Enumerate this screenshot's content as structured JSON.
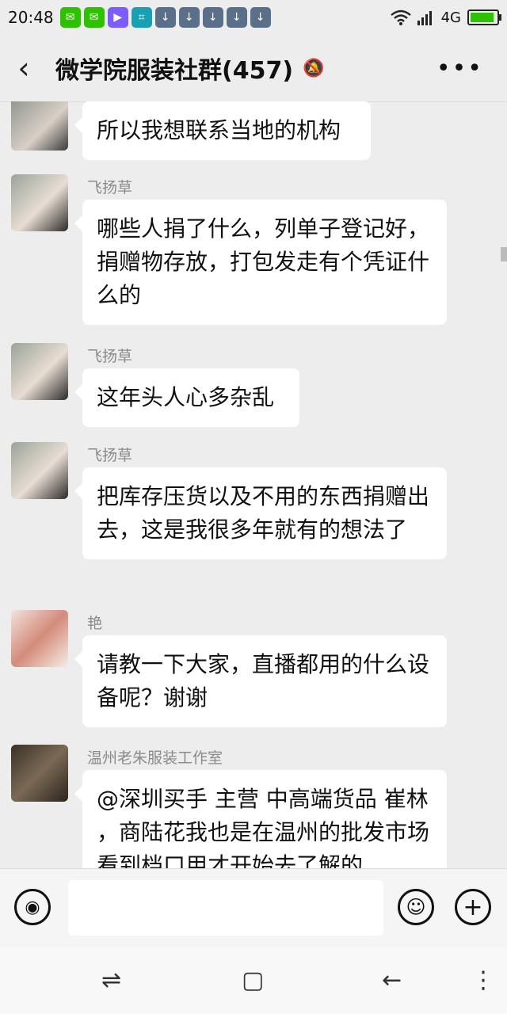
{
  "status": {
    "time": "20:48",
    "notifications": [
      {
        "icon": "wechat-icon",
        "glyph": "✉"
      },
      {
        "icon": "wechat-icon",
        "glyph": "✉"
      },
      {
        "icon": "video-icon",
        "glyph": "▶"
      },
      {
        "icon": "scan-icon",
        "glyph": "⌗"
      },
      {
        "icon": "download-icon",
        "glyph": "↓"
      },
      {
        "icon": "download-icon",
        "glyph": "↓"
      },
      {
        "icon": "download-icon",
        "glyph": "↓"
      },
      {
        "icon": "download-icon",
        "glyph": "↓"
      },
      {
        "icon": "download-icon",
        "glyph": "↓"
      }
    ],
    "network": "4G"
  },
  "header": {
    "back_glyph": "‹",
    "title": "微学院服装社群(457)",
    "mute_glyph": "🔕",
    "more_glyph": "•••"
  },
  "messages": [
    {
      "sender": "",
      "text": "所以我想联系当地的机构"
    },
    {
      "sender": "飞扬草",
      "text": "哪些人捐了什么，列单子登记好，捐赠物存放，打包发走有个凭证什么的"
    },
    {
      "sender": "飞扬草",
      "text": "这年头人心多杂乱"
    },
    {
      "sender": "飞扬草",
      "text": "把库存压货以及不用的东西捐赠出去，这是我很多年就有的想法了"
    },
    {
      "sender": "艳",
      "text": "请教一下大家，直播都用的什么设备呢？谢谢"
    },
    {
      "sender": "温州老朱服装工作室",
      "text": "@深圳买手  主营 中高端货品  崔林 ，商陆花我也是在温州的批发市场看到档口用才开始去了解的"
    }
  ],
  "input": {
    "voice_glyph": "◉",
    "emoji_glyph": "☺",
    "plus_glyph": "+"
  },
  "nav": {
    "switch_glyph": "⇌",
    "home_glyph": "▢",
    "back_glyph": "←",
    "menu_glyph": "⋮"
  },
  "colors": {
    "background": "#ededed",
    "bubble": "#ffffff",
    "sender": "#8a8a8a",
    "wechat_green": "#2dc100"
  }
}
